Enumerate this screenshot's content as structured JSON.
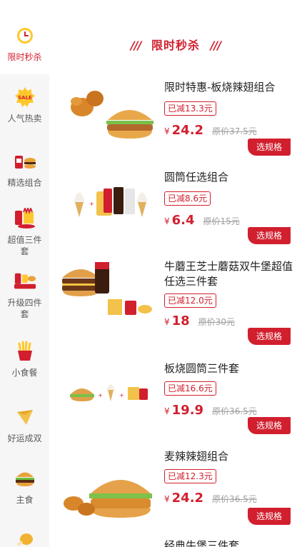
{
  "sidebar": {
    "items": [
      {
        "label": "限时秒杀",
        "icon": "clock-icon",
        "active": true
      },
      {
        "label": "人气热卖",
        "icon": "sale-badge-icon"
      },
      {
        "label": "精选组合",
        "icon": "combo-meal-icon"
      },
      {
        "label": "超值三件套",
        "icon": "three-piece-set-icon"
      },
      {
        "label": "升级四件套",
        "icon": "four-piece-set-icon"
      },
      {
        "label": "小食餐",
        "icon": "fries-icon"
      },
      {
        "label": "好运成双",
        "icon": "pie-icon"
      },
      {
        "label": "主食",
        "icon": "burger-icon"
      },
      {
        "label": "",
        "icon": "drumstick-icon"
      }
    ]
  },
  "main": {
    "section_title": "限时秒杀",
    "products": [
      {
        "name": "限时特惠-板烧辣翅组合",
        "discount": "已减13.3元",
        "currency": "¥",
        "price": "24.2",
        "original": "原价37.5元",
        "button": "选规格"
      },
      {
        "name": "圆筒任选组合",
        "discount": "已减8.6元",
        "currency": "¥",
        "price": "6.4",
        "original": "原价15元",
        "button": "选规格"
      },
      {
        "name": "牛蘑王芝士蘑菇双牛堡超值任选三件套",
        "discount": "已减12.0元",
        "currency": "¥",
        "price": "18",
        "original": "原价30元",
        "button": "选规格"
      },
      {
        "name": "板烧圆筒三件套",
        "discount": "已减16.6元",
        "currency": "¥",
        "price": "19.9",
        "original": "原价36.5元",
        "button": "选规格"
      },
      {
        "name": "麦辣辣翅组合",
        "discount": "已减12.3元",
        "currency": "¥",
        "price": "24.2",
        "original": "原价36.5元",
        "button": "选规格"
      },
      {
        "name": "经典牛堡三件套"
      }
    ]
  },
  "colors": {
    "accent": "#d11f2e",
    "sidebar_bg": "#f6f6f6",
    "muted": "#a0a0a0"
  }
}
